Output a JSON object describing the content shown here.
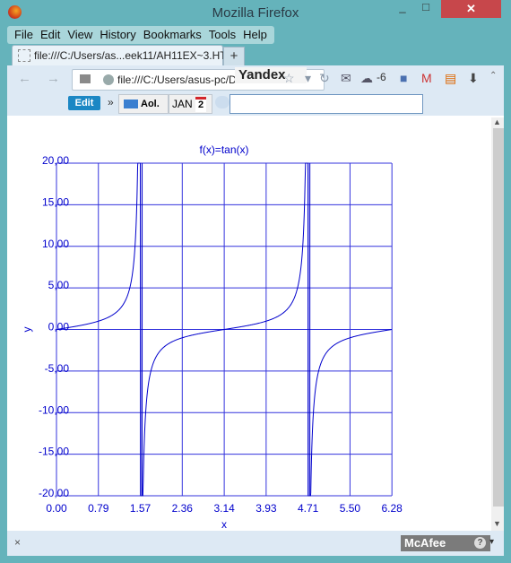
{
  "window": {
    "title": "Mozilla Firefox",
    "minimize": "_",
    "maximize": "□",
    "close": "✕"
  },
  "menu": [
    "File",
    "Edit",
    "View",
    "History",
    "Bookmarks",
    "Tools",
    "Help"
  ],
  "tab": {
    "label": "file:///C:/Users/as...eek11/AH11EX~3.HTM",
    "new_tab": "+"
  },
  "nav": {
    "back": "←",
    "forward": "→",
    "url": "file:///C:/Users/asus-pc/D",
    "search_engine": "Yandex",
    "icons": "☆ ▾ C  ✉ ☁ -6",
    "weather": "-6"
  },
  "toolbar2": {
    "edit": "Edit",
    "chevron": "»",
    "aol": "Aol.",
    "jan": "JAN",
    "jan_day": "2",
    "search_value": ""
  },
  "status": {
    "close": "×",
    "mcafee": "McAfee",
    "help": "?",
    "dropdown": "▾"
  },
  "colors": {
    "plot": "#0000cc",
    "grid": "#3333dd"
  },
  "chart_data": {
    "type": "line",
    "title": "f(x)=tan(x)",
    "xlabel": "x",
    "ylabel": "y",
    "xlim": [
      0,
      6.28
    ],
    "ylim": [
      -20,
      20
    ],
    "grid": true,
    "x_tick_labels": [
      "0.00",
      "0.79",
      "1.57",
      "2.36",
      "3.14",
      "3.93",
      "4.71",
      "5.50",
      "6.28"
    ],
    "y_tick_labels": [
      "20,00",
      "15,00",
      "10,00",
      "5,00",
      "0,00",
      "-5,00",
      "-10,00",
      "-15,00",
      "-20,00"
    ],
    "x_ticks": [
      0,
      0.785,
      1.571,
      2.356,
      3.142,
      3.927,
      4.712,
      5.498,
      6.283
    ],
    "y_ticks": [
      20,
      15,
      10,
      5,
      0,
      -5,
      -10,
      -15,
      -20
    ],
    "series": [
      {
        "name": "tan(x)",
        "function": "tan",
        "x_range": [
          0,
          6.283
        ]
      }
    ]
  }
}
